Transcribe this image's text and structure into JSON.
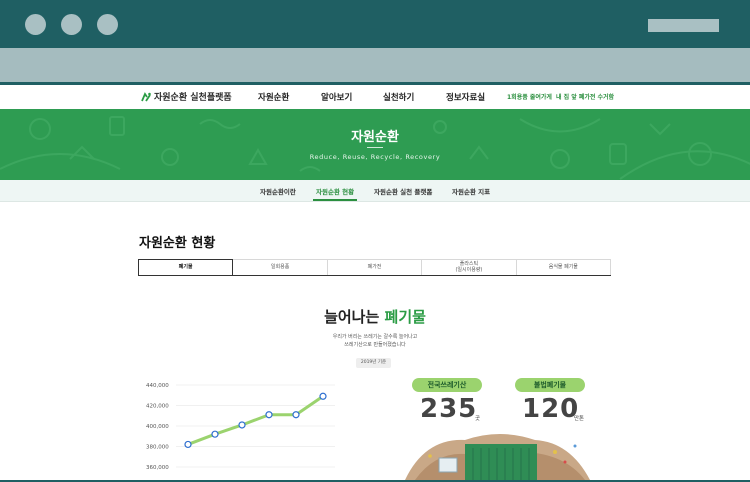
{
  "site": {
    "logo_text": "자원순환 실천플랫폼",
    "nav": [
      "자원순환",
      "알아보기",
      "실천하기",
      "정보자료실"
    ],
    "links": [
      "1회용품 줄여가게",
      "내 집 앞 폐가전 수거함"
    ]
  },
  "banner": {
    "title": "자원순환",
    "subtitle": "Reduce, Reuse, Recycle, Recovery"
  },
  "subnav": {
    "items": [
      "자원순환이란",
      "자원순환 현황",
      "자원순환 실천 플랫폼",
      "자원순환 지표"
    ],
    "active_index": 1
  },
  "page": {
    "title": "자원순환 현황"
  },
  "tabs": {
    "items": [
      {
        "line1": "폐기물",
        "line2": ""
      },
      {
        "line1": "일회용품",
        "line2": ""
      },
      {
        "line1": "폐가전",
        "line2": ""
      },
      {
        "line1": "플라스틱",
        "line2": "(일시이용량)"
      },
      {
        "line1": "음식물 폐기물",
        "line2": ""
      }
    ],
    "active_index": 0
  },
  "infographic": {
    "title_prefix": "늘어나는",
    "title_highlight": "폐기물",
    "desc_line1": "우리가 버리는 쓰레기는 갈수록 늘어나고",
    "desc_line2": "쓰레기산으로 만들어졌습니다",
    "year_badge": "2019년 기준"
  },
  "chart_data": {
    "type": "line",
    "y_ticks": [
      "440,000",
      "420,000",
      "400,000",
      "380,000",
      "360,000"
    ],
    "ylim": [
      360000,
      440000
    ],
    "values": [
      382000,
      392000,
      401000,
      411000,
      411000,
      429000
    ],
    "line_color": "#9bd36e",
    "marker_color": "#2f6fd0"
  },
  "stats": [
    {
      "label": "전국쓰레기산",
      "value": "235",
      "unit": "곳"
    },
    {
      "label": "불법폐기물",
      "value": "120",
      "unit": "만톤"
    }
  ],
  "colors": {
    "chrome_dark": "#1f5f63",
    "brand_green": "#2e9c52",
    "accent_green": "#2b9c45",
    "pill_green": "#9bd36e"
  }
}
